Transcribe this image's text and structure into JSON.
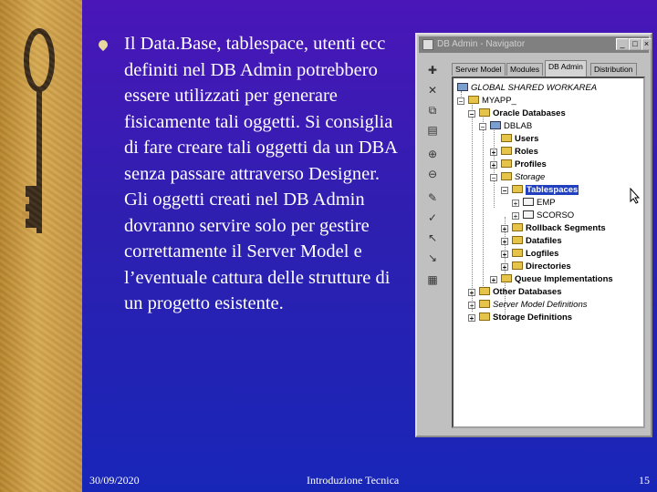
{
  "slide": {
    "body": "Il Data.Base, tablespace, utenti ecc definiti nel DB Admin potrebbero essere utilizzati per generare fisicamente tali oggetti. Si consiglia di fare creare tali oggetti da un DBA senza passare attraverso Designer. Gli oggetti creati nel DB Admin dovranno servire solo per gestire correttamente il Server Model e l’eventuale cattura delle strutture di un progetto esistente.",
    "footer_date": "30/09/2020",
    "footer_center": "Introduzione Tecnica",
    "page_number": "15"
  },
  "window": {
    "title": "DB Admin - Navigator",
    "minimize": "_",
    "maximize": "□",
    "close": "×",
    "tabs": [
      "Server Model",
      "Modules",
      "DB Admin",
      "Distribution"
    ],
    "active_tab": "DB Admin",
    "tree": {
      "workarea": "GLOBAL SHARED WORKAREA",
      "app": "MYAPP_",
      "oracle_databases": "Oracle Databases",
      "dblab": "DBLAB",
      "users": "Users",
      "roles": "Roles",
      "profiles": "Profiles",
      "storage": "Storage",
      "tablespaces": "Tablespaces",
      "emp": "EMP",
      "scorso": "SCORSO",
      "rollback_segments": "Rollback Segments",
      "datafiles": "Datafiles",
      "logfiles": "Logfiles",
      "directories": "Directories",
      "queue_implementations": "Queue Implementations",
      "other_databases": "Other Databases",
      "server_model_definitions": "Server Model Definitions",
      "storage_definitions": "Storage Definitions"
    }
  },
  "colors": {
    "background": "#2e1fb0",
    "sidebar": "#c59440",
    "selection": "#2040c0"
  }
}
